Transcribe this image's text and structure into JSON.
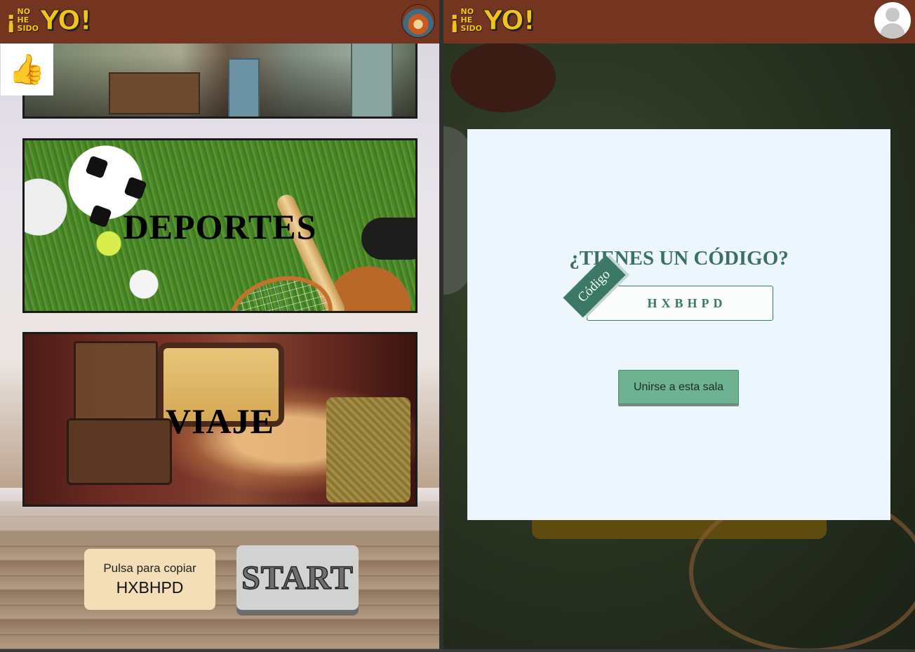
{
  "left_pane": {
    "logo": {
      "exclaim": "¡",
      "line1": "NO",
      "line2": "HE",
      "line3": "SIDO",
      "yo": "YO!"
    },
    "like_icon": "👍",
    "categories": [
      {
        "label": ""
      },
      {
        "label": "DEPORTES"
      },
      {
        "label": "VIAJE"
      }
    ],
    "copy_box": {
      "hint": "Pulsa para copiar",
      "code": "HXBHPD"
    },
    "start_label": "START"
  },
  "right_pane": {
    "logo": {
      "exclaim": "¡",
      "line1": "NO",
      "line2": "HE",
      "line3": "SIDO",
      "yo": "YO!"
    },
    "modal": {
      "title": "¿TIENES UN CÓDIGO?",
      "tag_label": "Código",
      "input_value": "HXBHPD",
      "join_label": "Unirse a esta sala"
    }
  },
  "colors": {
    "topbar": "#733520",
    "accent_green": "#3b7866",
    "button_green": "#6db291",
    "copy_box_bg": "#f4deb8",
    "logo_yellow": "#f2c31b"
  },
  "icons": [
    "thumbs-up-icon",
    "scream-avatar",
    "user-avatar-icon"
  ]
}
